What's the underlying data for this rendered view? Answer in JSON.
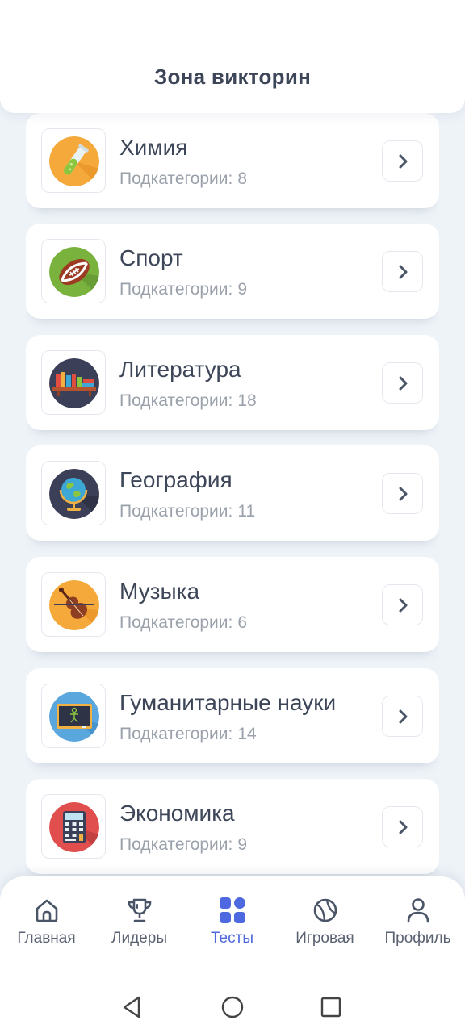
{
  "header": {
    "title": "Зона викторин"
  },
  "categories": [
    {
      "name": "Химия",
      "sub_label": "Подкатегории:",
      "count": "8",
      "icon": "chemistry-flask-icon"
    },
    {
      "name": "Спорт",
      "sub_label": "Подкатегории:",
      "count": "9",
      "icon": "football-icon"
    },
    {
      "name": "Литература",
      "sub_label": "Подкатегории:",
      "count": "18",
      "icon": "bookshelf-icon"
    },
    {
      "name": "География",
      "sub_label": "Подкатегории:",
      "count": "11",
      "icon": "globe-icon"
    },
    {
      "name": "Музыка",
      "sub_label": "Подкатегории:",
      "count": "6",
      "icon": "violin-icon"
    },
    {
      "name": "Гуманитарные науки",
      "sub_label": "Подкатегории:",
      "count": "14",
      "icon": "chalkboard-icon"
    },
    {
      "name": "Экономика",
      "sub_label": "Подкатегории:",
      "count": "9",
      "icon": "calculator-icon"
    }
  ],
  "nav": [
    {
      "label": "Главная",
      "icon": "home-icon",
      "active": false
    },
    {
      "label": "Лидеры",
      "icon": "trophy-icon",
      "active": false
    },
    {
      "label": "Тесты",
      "icon": "grid-icon",
      "active": true
    },
    {
      "label": "Игровая",
      "icon": "ball-icon",
      "active": false
    },
    {
      "label": "Профиль",
      "icon": "user-icon",
      "active": false
    }
  ],
  "colors": {
    "accent": "#4e68e0",
    "background": "#eef3f8",
    "title_text": "#3d4658",
    "subtitle_text": "#9aa1ab"
  }
}
